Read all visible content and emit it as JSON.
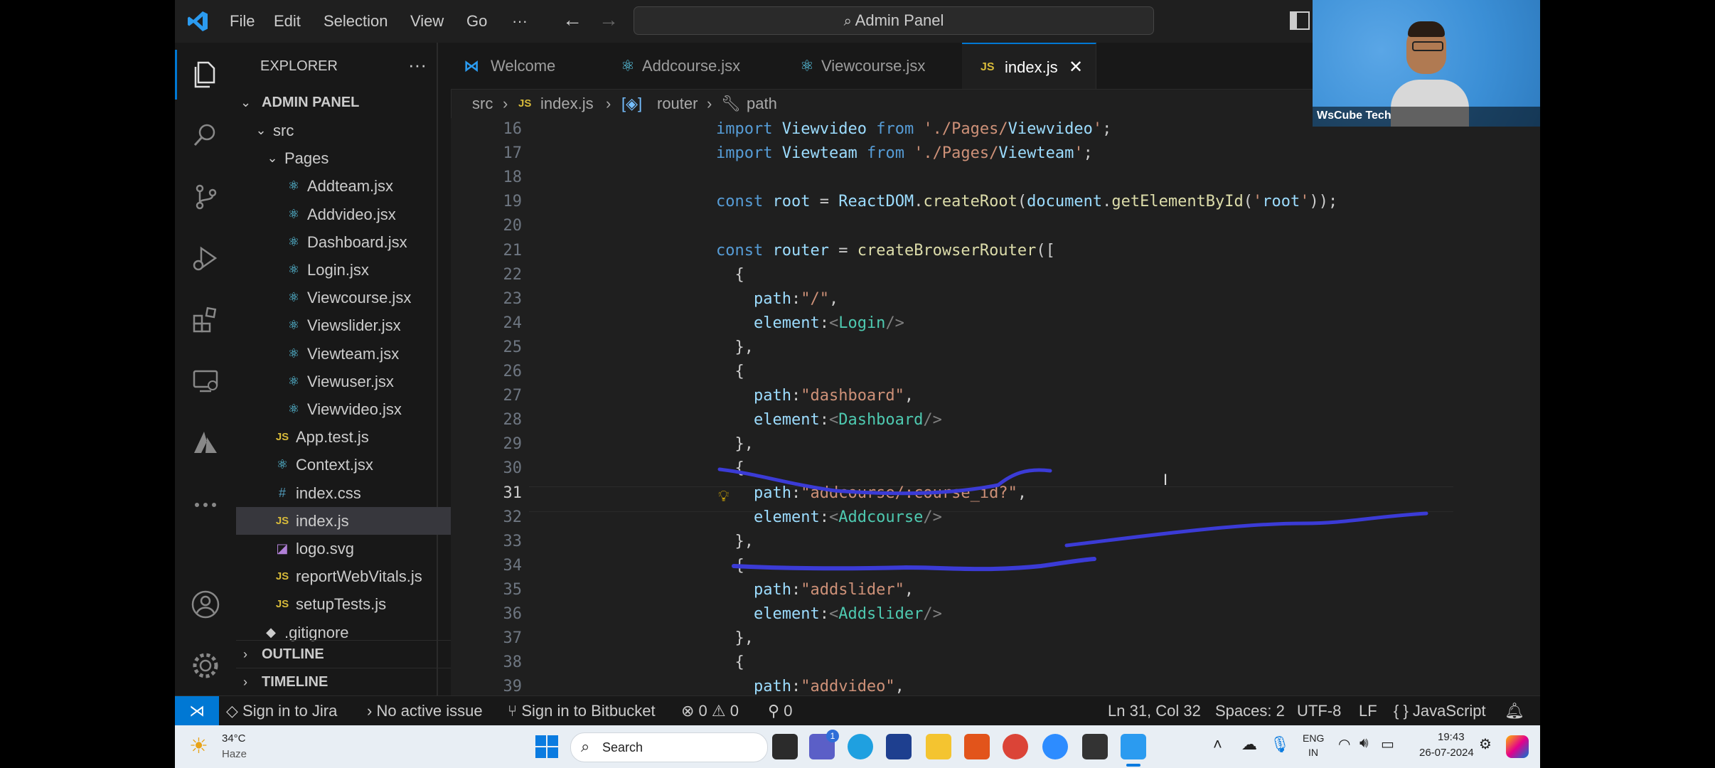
{
  "titlebar": {
    "menu": [
      "File",
      "Edit",
      "Selection",
      "View",
      "Go",
      "···"
    ],
    "command_center": "Admin Panel"
  },
  "sidebar": {
    "header": "EXPLORER",
    "more": "···",
    "project": "ADMIN PANEL",
    "tree": [
      {
        "label": "src",
        "type": "folder",
        "depth": 1
      },
      {
        "label": "Pages",
        "type": "folder",
        "depth": 2
      },
      {
        "label": "Addteam.jsx",
        "type": "react",
        "depth": 3
      },
      {
        "label": "Addvideo.jsx",
        "type": "react",
        "depth": 3
      },
      {
        "label": "Dashboard.jsx",
        "type": "react",
        "depth": 3
      },
      {
        "label": "Login.jsx",
        "type": "react",
        "depth": 3
      },
      {
        "label": "Viewcourse.jsx",
        "type": "react",
        "depth": 3
      },
      {
        "label": "Viewslider.jsx",
        "type": "react",
        "depth": 3
      },
      {
        "label": "Viewteam.jsx",
        "type": "react",
        "depth": 3
      },
      {
        "label": "Viewuser.jsx",
        "type": "react",
        "depth": 3
      },
      {
        "label": "Viewvideo.jsx",
        "type": "react",
        "depth": 3
      },
      {
        "label": "App.test.js",
        "type": "js",
        "depth": 2
      },
      {
        "label": "Context.jsx",
        "type": "react",
        "depth": 2
      },
      {
        "label": "index.css",
        "type": "css",
        "depth": 2
      },
      {
        "label": "index.js",
        "type": "js",
        "depth": 2,
        "selected": true
      },
      {
        "label": "logo.svg",
        "type": "svg",
        "depth": 2
      },
      {
        "label": "reportWebVitals.js",
        "type": "js",
        "depth": 2
      },
      {
        "label": "setupTests.js",
        "type": "js",
        "depth": 2
      },
      {
        "label": ".gitignore",
        "type": "git",
        "depth": 1
      }
    ],
    "outline": "OUTLINE",
    "timeline": "TIMELINE"
  },
  "tabs": [
    {
      "label": "Welcome",
      "icon": "vscode-icon"
    },
    {
      "label": "Addcourse.jsx",
      "icon": "react-icon"
    },
    {
      "label": "Viewcourse.jsx",
      "icon": "react-icon"
    },
    {
      "label": "index.js",
      "icon": "js-icon",
      "active": true
    }
  ],
  "breadcrumbs": [
    "src",
    "index.js",
    "router",
    "path"
  ],
  "editor": {
    "current_line": 31,
    "lines": [
      {
        "n": 16,
        "text": "import Viewvideo from './Pages/Viewvideo';"
      },
      {
        "n": 17,
        "text": "import Viewteam from './Pages/Viewteam';"
      },
      {
        "n": 18,
        "text": ""
      },
      {
        "n": 19,
        "text": "const root = ReactDOM.createRoot(document.getElementById('root'));"
      },
      {
        "n": 20,
        "text": ""
      },
      {
        "n": 21,
        "text": "const router = createBrowserRouter(["
      },
      {
        "n": 22,
        "text": "  {"
      },
      {
        "n": 23,
        "text": "    path:\"/\","
      },
      {
        "n": 24,
        "text": "    element:<Login/>"
      },
      {
        "n": 25,
        "text": "  },"
      },
      {
        "n": 26,
        "text": "  {"
      },
      {
        "n": 27,
        "text": "    path:\"dashboard\","
      },
      {
        "n": 28,
        "text": "    element:<Dashboard/>"
      },
      {
        "n": 29,
        "text": "  },"
      },
      {
        "n": 30,
        "text": "  {"
      },
      {
        "n": 31,
        "text": "    path:\"addcourse/:course_id?\","
      },
      {
        "n": 32,
        "text": "    element:<Addcourse/>"
      },
      {
        "n": 33,
        "text": "  },"
      },
      {
        "n": 34,
        "text": "  {"
      },
      {
        "n": 35,
        "text": "    path:\"addslider\","
      },
      {
        "n": 36,
        "text": "    element:<Addslider/>"
      },
      {
        "n": 37,
        "text": "  },"
      },
      {
        "n": 38,
        "text": "  {"
      },
      {
        "n": 39,
        "text": "    path:\"addvideo\","
      }
    ]
  },
  "statusbar": {
    "jira": "Sign in to Jira",
    "issue": "No active issue",
    "bitbucket": "Sign in to Bitbucket",
    "errors": "0",
    "warnings": "0",
    "ports": "0",
    "position": "Ln 31, Col 32",
    "spaces": "Spaces: 2",
    "encoding": "UTF-8",
    "eol": "LF",
    "language": "JavaScript"
  },
  "taskbar": {
    "weather_temp": "34°C",
    "weather_desc": "Haze",
    "search": "Search",
    "lang_top": "ENG",
    "lang_bottom": "IN",
    "time": "19:43",
    "date": "26-07-2024",
    "teams_badge": "1"
  },
  "webcam": {
    "name": "WsCube Tech"
  },
  "colors": {
    "accent": "#0078d4",
    "annotation": "#3b3bd6",
    "editor_bg": "#1f1f1f",
    "sidebar_bg": "#181818"
  }
}
